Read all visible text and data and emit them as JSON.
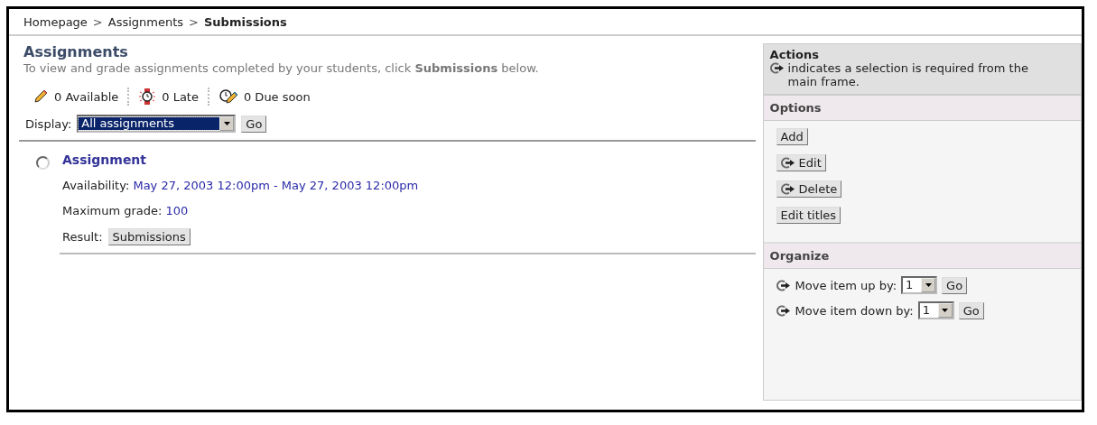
{
  "breadcrumb": [
    {
      "kind": "link",
      "text": "Homepage"
    },
    {
      "kind": "separator",
      "text": ">"
    },
    {
      "kind": "link",
      "text": "Assignments"
    },
    {
      "kind": "separator",
      "text": ">"
    },
    {
      "kind": "current",
      "text": "Submissions"
    }
  ],
  "page": {
    "title": "Assignments",
    "description": "To view and grade assignments completed by your students, click **Submissions** below."
  },
  "counts": [
    {
      "kind": "available",
      "text": "0 Available"
    },
    {
      "kind": "late",
      "text": "0 Late"
    },
    {
      "kind": "due",
      "text": "0 Due soon"
    }
  ],
  "display": {
    "label": "Display:",
    "value": "All assignments",
    "button": "Go"
  },
  "assignments": [
    {
      "title": "Assignment",
      "selected": false,
      "fields": [
        {
          "label": "Availability:",
          "value": "May 27, 2003 12:00pm - May 27, 2003 12:00pm"
        },
        {
          "label": "Maximum grade:",
          "value": "100"
        }
      ],
      "result_label": "Result:",
      "result_button": "Submissions"
    }
  ],
  "sidebar": {
    "title": "Actions",
    "note": "indicates a selection is required from the main frame.",
    "options_title": "Options",
    "options": [
      {
        "label": "Add",
        "requires_selection": false
      },
      {
        "label": "Edit",
        "requires_selection": true
      },
      {
        "label": "Delete",
        "requires_selection": true
      },
      {
        "label": "Edit titles",
        "requires_selection": false
      }
    ],
    "organize_title": "Organize",
    "organize": [
      {
        "label": "Move item up by:",
        "value": "1",
        "button": "Go"
      },
      {
        "label": "Move item down by:",
        "value": "1",
        "button": "Go"
      }
    ]
  }
}
